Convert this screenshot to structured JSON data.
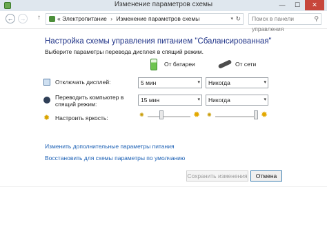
{
  "window": {
    "title": "Изменение параметров схемы",
    "minimize_label": "—",
    "maximize_label": "☐",
    "close_label": "✕"
  },
  "nav": {
    "back_label": "←",
    "forward_label": "→",
    "up_label": "↑",
    "breadcrumbs": [
      "Электропитание",
      "Изменение параметров схемы"
    ],
    "separator": "›",
    "leading_separator": "«",
    "dropdown_label": "▾",
    "refresh_label": "↻",
    "search_placeholder": "Поиск в панели управления",
    "search_icon": "⚲"
  },
  "main": {
    "heading": "Настройка схемы управления питанием \"Сбалансированная\"",
    "subheading": "Выберите параметры перевода дисплея в спящий режим.",
    "columns": {
      "battery_label": "От батареи",
      "ac_label": "От сети"
    },
    "rows": {
      "display": {
        "label": "Отключать дисплей:",
        "battery_value": "5 мин",
        "ac_value": "Никогда"
      },
      "sleep": {
        "label": "Переводить компьютер в спящий режим:",
        "battery_value": "15 мин",
        "ac_value": "Никогда"
      },
      "brightness": {
        "label": "Настроить яркость:",
        "battery_level": 0.33,
        "ac_level": 0.95,
        "sun_small": "✺",
        "sun_big": "✹"
      }
    },
    "chevron": "▾",
    "links": {
      "advanced": "Изменить дополнительные параметры питания",
      "restore": "Восстановить для схемы параметры по умолчанию"
    },
    "buttons": {
      "save": "Сохранить изменения",
      "cancel": "Отмена"
    }
  },
  "colors": {
    "heading": "#1e3287",
    "link": "#1a5fb4",
    "close_button": "#c7463b"
  }
}
